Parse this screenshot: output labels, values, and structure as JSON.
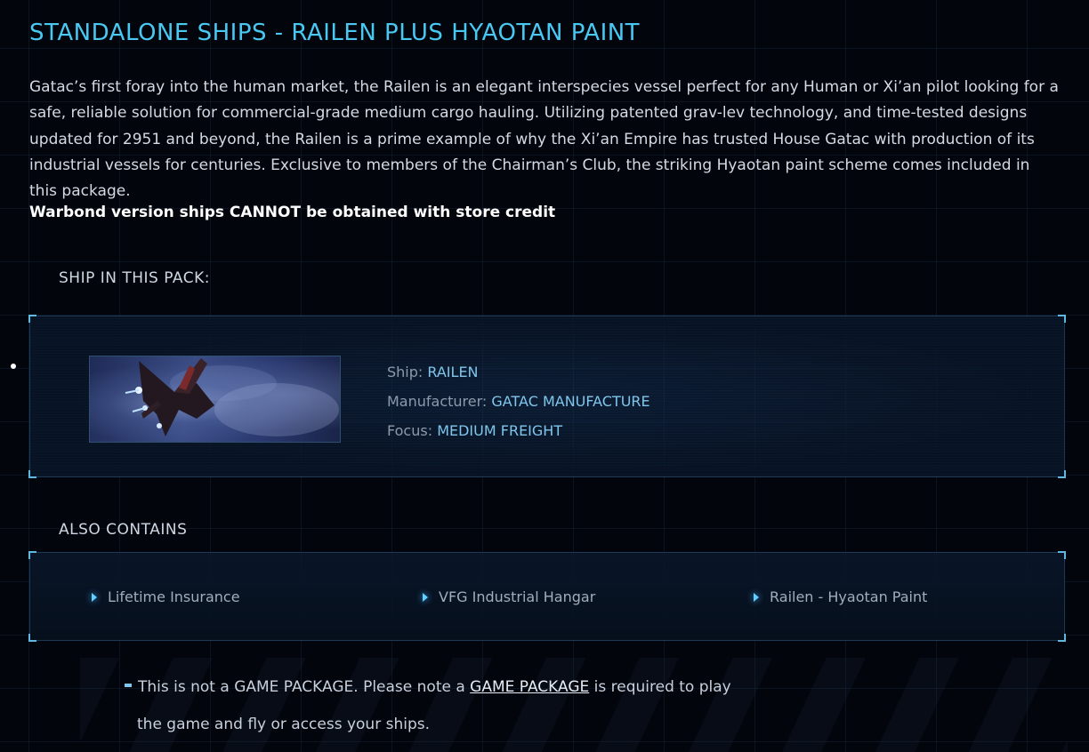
{
  "page_title": "STANDALONE SHIPS - RAILEN PLUS HYAOTAN PAINT",
  "description": "Gatac’s first foray into the human market, the Railen is an elegant interspecies vessel perfect for any Human or Xi’an pilot looking for a safe, reliable solution for commercial-grade medium cargo hauling. Utilizing patented grav-lev technology, and time-tested designs updated for 2951 and beyond, the Railen is a prime example of why the Xi’an Empire has trusted House Gatac with production of its industrial vessels for centuries. Exclusive to members of the Chairman’s Club, the striking Hyaotan paint scheme comes included in this package.",
  "warning": "Warbond version ships CANNOT be obtained with store credit",
  "ship_section": {
    "label": "SHIP IN THIS PACK:",
    "ship": {
      "ship_label": "Ship:",
      "ship_value": "RAILEN",
      "manufacturer_label": "Manufacturer:",
      "manufacturer_value": "GATAC MANUFACTURE",
      "focus_label": "Focus:",
      "focus_value": "MEDIUM FREIGHT"
    }
  },
  "contains_section": {
    "label": "ALSO CONTAINS",
    "items": [
      {
        "label": "Lifetime Insurance",
        "icon": "chevron-right-icon"
      },
      {
        "label": "VFG Industrial Hangar",
        "icon": "chevron-right-icon"
      },
      {
        "label": "Railen - Hyaotan Paint",
        "icon": "chevron-right-icon"
      }
    ]
  },
  "note": {
    "prefix": "This is not a GAME PACKAGE. Please note a ",
    "link": "GAME PACKAGE",
    "suffix": " is required to play",
    "line2": "the game and fly or access your ships."
  },
  "colors": {
    "title": "#49c8f2",
    "accent_value": "#7fc6ec",
    "background": "#02050c"
  }
}
